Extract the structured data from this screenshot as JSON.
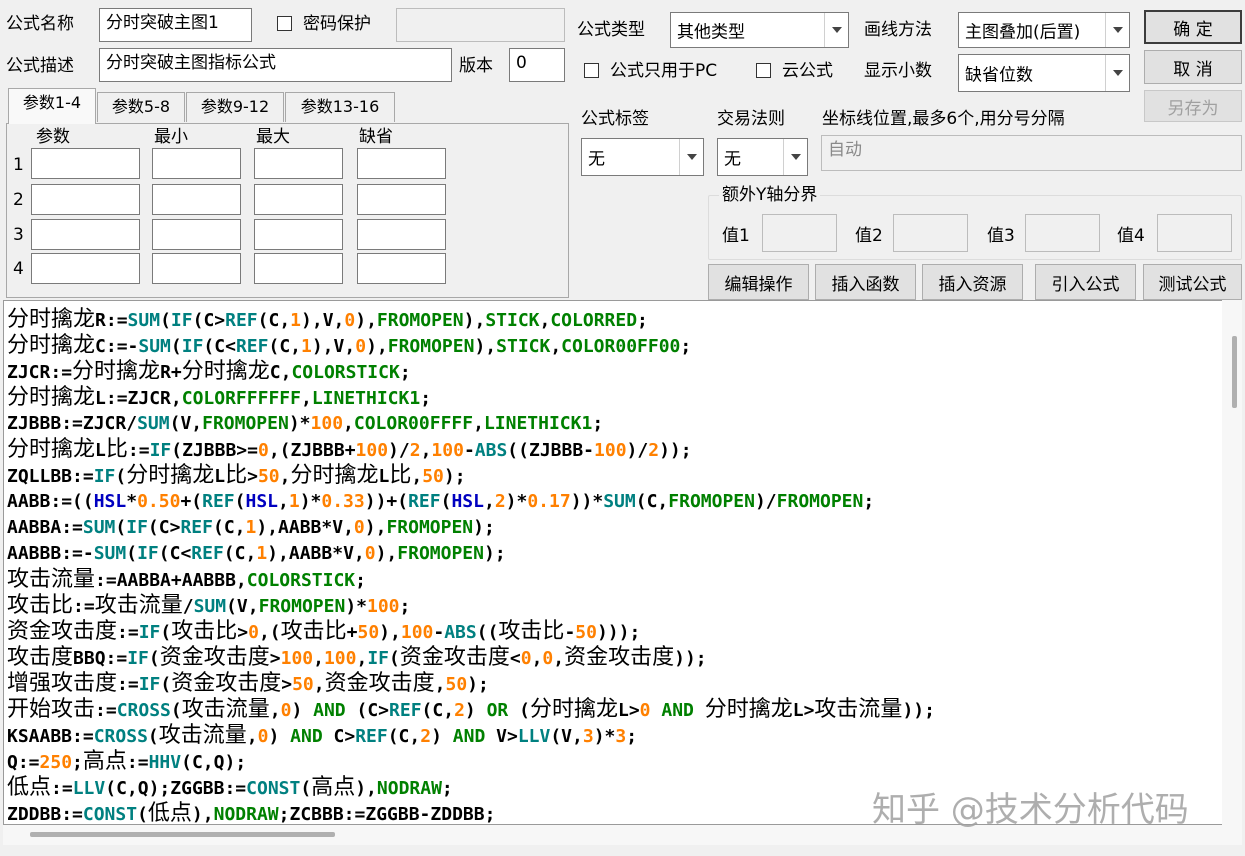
{
  "labels": {
    "formula_name": "公式名称",
    "password": "密码保护",
    "formula_type": "公式类型",
    "draw_method": "画线方法",
    "formula_desc": "公式描述",
    "version": "版本",
    "pc_only": "公式只用于PC",
    "cloud": "云公式",
    "decimals": "显示小数",
    "tag": "公式标签",
    "trade_rule": "交易法则",
    "axis_pos": "坐标线位置,最多6个,用分号分隔",
    "extra_y": "额外Y轴分界",
    "val1": "值1",
    "val2": "值2",
    "val3": "值3",
    "val4": "值4"
  },
  "fields": {
    "name": "分时突破主图1",
    "password": "",
    "desc": "分时突破主图指标公式",
    "version": "0",
    "type": "其他类型",
    "draw": "主图叠加(后置)",
    "decimals": "缺省位数",
    "tag": "无",
    "rule": "无",
    "axis_placeholder": "自动"
  },
  "buttons": {
    "ok": "确  定",
    "cancel": "取  消",
    "save_as": "另存为",
    "edit": "编辑操作",
    "insert_func": "插入函数",
    "insert_res": "插入资源",
    "import": "引入公式",
    "test": "测试公式"
  },
  "tabs": [
    "参数1-4",
    "参数5-8",
    "参数9-12",
    "参数13-16"
  ],
  "param_headers": [
    "参数",
    "最小",
    "最大",
    "缺省"
  ],
  "param_rows": [
    "1",
    "2",
    "3",
    "4"
  ],
  "code_lines": [
    "分时擒龙R:=SUM(IF(C>REF(C,1),V,0),FROMOPEN),STICK,COLORRED;",
    "分时擒龙C:=-SUM(IF(C<REF(C,1),V,0),FROMOPEN),STICK,COLOR00FF00;",
    "ZJCR:=分时擒龙R+分时擒龙C,COLORSTICK;",
    "分时擒龙L:=ZJCR,COLORFFFFFF,LINETHICK1;",
    "ZJBBB:=ZJCR/SUM(V,FROMOPEN)*100,COLOR00FFFF,LINETHICK1;",
    "分时擒龙L比:=IF(ZJBBB>=0,(ZJBBB+100)/2,100-ABS((ZJBBB-100)/2));",
    "ZQLLBB:=IF(分时擒龙L比>50,分时擒龙L比,50);",
    "AABB:=((HSL*0.50+(REF(HSL,1)*0.33))+(REF(HSL,2)*0.17))*SUM(C,FROMOPEN)/FROMOPEN;",
    "AABBA:=SUM(IF(C>REF(C,1),AABB*V,0),FROMOPEN);",
    "AABBB:=-SUM(IF(C<REF(C,1),AABB*V,0),FROMOPEN);",
    "攻击流量:=AABBA+AABBB,COLORSTICK;",
    "攻击比:=攻击流量/SUM(V,FROMOPEN)*100;",
    "资金攻击度:=IF(攻击比>0,(攻击比+50),100-ABS((攻击比-50)));",
    "攻击度BBQ:=IF(资金攻击度>100,100,IF(资金攻击度<0,0,资金攻击度));",
    "增强攻击度:=IF(资金攻击度>50,资金攻击度,50);",
    "开始攻击:=CROSS(攻击流量,0) AND (C>REF(C,2) OR (分时擒龙L>0 AND 分时擒龙L>攻击流量));",
    "KSAABB:=CROSS(攻击流量,0) AND C>REF(C,2) AND V>LLV(V,3)*3;",
    "Q:=250;高点:=HHV(C,Q);",
    "低点:=LLV(C,Q);ZGGBB:=CONST(高点),NODRAW;",
    "ZDDBB:=CONST(低点),NODRAW;ZCBBB:=ZGGBB-ZDDBB;"
  ],
  "watermark": "知乎 @技术分析代码",
  "colors": {
    "function": "#008080",
    "number": "#ff8000",
    "color_const": "#008000",
    "keyword": "#0000c0",
    "text": "#000000"
  }
}
